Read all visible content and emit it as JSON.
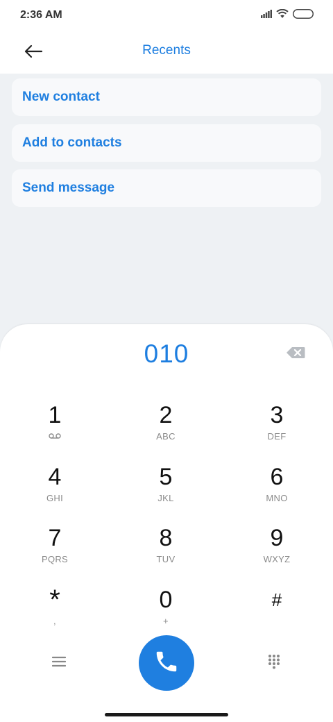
{
  "status": {
    "time": "2:36 AM"
  },
  "header": {
    "title": "Recents"
  },
  "actions": [
    {
      "label": "New contact"
    },
    {
      "label": "Add to contacts"
    },
    {
      "label": "Send message"
    }
  ],
  "dialer": {
    "number": "010",
    "keys": [
      {
        "digit": "1",
        "letters": ""
      },
      {
        "digit": "2",
        "letters": "ABC"
      },
      {
        "digit": "3",
        "letters": "DEF"
      },
      {
        "digit": "4",
        "letters": "GHI"
      },
      {
        "digit": "5",
        "letters": "JKL"
      },
      {
        "digit": "6",
        "letters": "MNO"
      },
      {
        "digit": "7",
        "letters": "PQRS"
      },
      {
        "digit": "8",
        "letters": "TUV"
      },
      {
        "digit": "9",
        "letters": "WXYZ"
      },
      {
        "digit": "*",
        "letters": ","
      },
      {
        "digit": "0",
        "letters": "+"
      },
      {
        "digit": "#",
        "letters": ""
      }
    ]
  },
  "icons": {
    "back": "arrow-left-icon",
    "backspace": "backspace-icon",
    "voicemail": "voicemail-icon",
    "call": "phone-icon",
    "menu": "menu-icon",
    "keypad": "dialpad-icon",
    "signal": "signal-icon",
    "wifi": "wifi-icon",
    "battery": "battery-icon"
  },
  "colors": {
    "accent": "#1f7fe0",
    "background": "#eef1f4",
    "card": "#f8f9fb"
  }
}
